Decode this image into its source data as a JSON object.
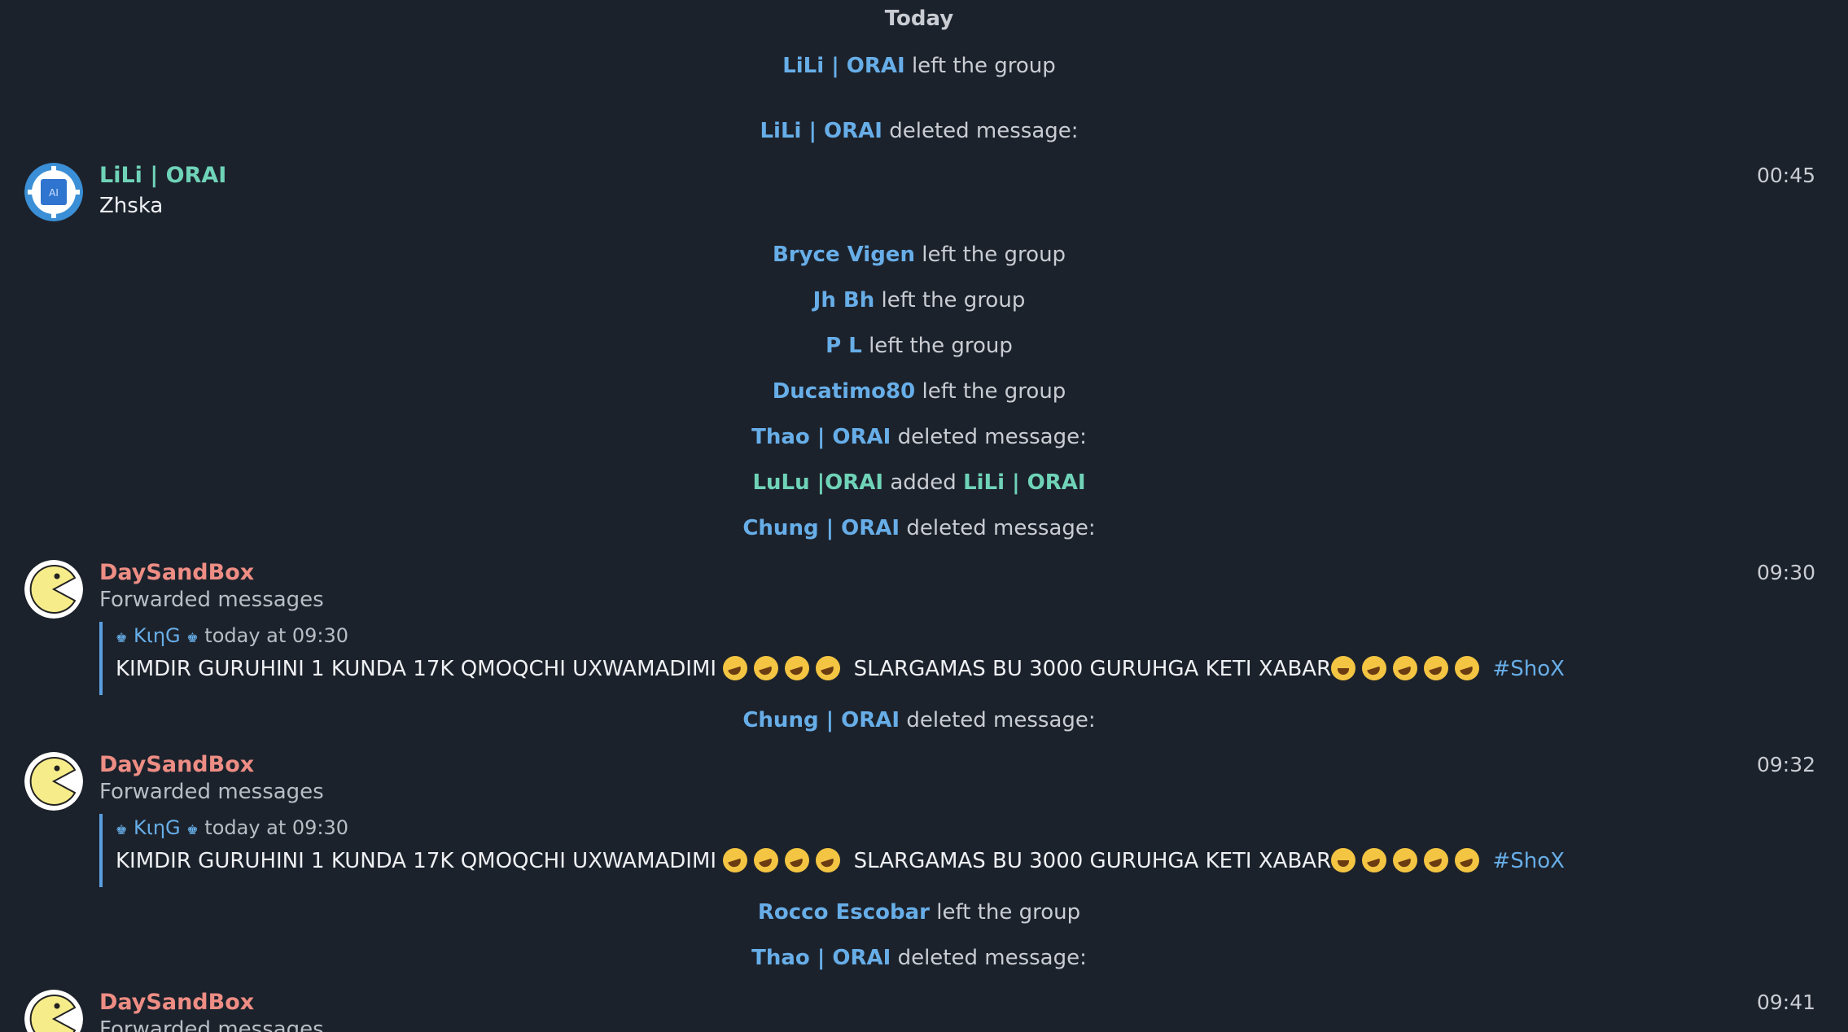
{
  "day_separator": "Today",
  "service_messages": [
    {
      "actor": "LiLi | ORAI",
      "action": "left the group"
    },
    {
      "actor": "LiLi | ORAI",
      "action": "deleted message:"
    },
    {
      "actor": "Bryce Vigen",
      "action": "left the group"
    },
    {
      "actor": "Jh Bh",
      "action": "left the group"
    },
    {
      "actor": "P L",
      "action": "left the group"
    },
    {
      "actor": "Ducatimo80",
      "action": "left the group"
    },
    {
      "actor": "Thao | ORAI",
      "action": "deleted message:"
    },
    {
      "actor": "LuLu |ORAI",
      "action": "added",
      "target": "LiLi | ORAI"
    },
    {
      "actor": "Chung | ORAI",
      "action": "deleted message:"
    },
    {
      "actor": "Chung | ORAI",
      "action": "deleted message:"
    },
    {
      "actor": "Rocco Escobar",
      "action": "left the group"
    },
    {
      "actor": "Thao | ORAI",
      "action": "deleted message:"
    }
  ],
  "messages": [
    {
      "sender": "LiLi | ORAI",
      "text": "Zhska",
      "time": "00:45",
      "avatar_icon": "ai-chip-icon"
    },
    {
      "sender": "DaySandBox",
      "label": "Forwarded messages",
      "time": "09:30",
      "avatar_icon": "pacman-icon",
      "forward": {
        "from": "KιηG",
        "when": "today at 09:30",
        "text": "KIMDIR GURUHINI 1 KUNDA 17K QMOQCHI UXWAMADIMI",
        "text2": "SLARGAMAS BU 3000 GURUHGA KETI XABAR",
        "hashtag": "#ShoX"
      }
    },
    {
      "sender": "DaySandBox",
      "label": "Forwarded messages",
      "time": "09:32",
      "avatar_icon": "pacman-icon",
      "forward": {
        "from": "KιηG",
        "when": "today at 09:30",
        "text": "KIMDIR GURUHINI 1 KUNDA 17K QMOQCHI UXWAMADIMI",
        "text2": "SLARGAMAS BU 3000 GURUHGA KETI XABAR",
        "hashtag": "#ShoX"
      }
    },
    {
      "sender": "DaySandBox",
      "label": "Forwarded messages",
      "time": "09:41",
      "avatar_icon": "pacman-icon"
    }
  ],
  "colors": {
    "background": "#1c222c",
    "link_blue": "#67aee8",
    "name_green": "#6fd3b8",
    "name_red": "#ee8d84",
    "quote_bar": "#5a9fe0"
  }
}
